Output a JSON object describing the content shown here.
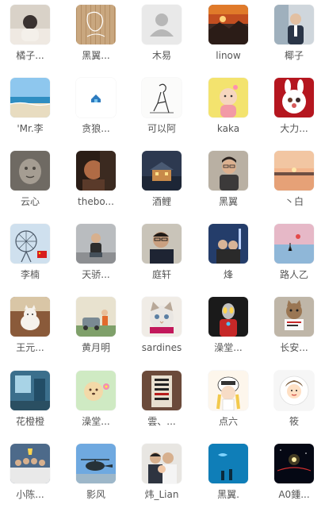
{
  "contacts": [
    {
      "name": "橘子...",
      "avatar": "photo-person-woman-light"
    },
    {
      "name": "黑翼...",
      "avatar": "photo-sketch-wood"
    },
    {
      "name": "木易",
      "avatar": "default-user-icon"
    },
    {
      "name": "linow",
      "avatar": "photo-sunset-mountains"
    },
    {
      "name": "椰子",
      "avatar": "photo-man-suit-office"
    },
    {
      "name": "'Mr.李",
      "avatar": "photo-beach-sea"
    },
    {
      "name": "贪狼...",
      "avatar": "small-house-logo"
    },
    {
      "name": "可以阿",
      "avatar": "line-drawing-figure"
    },
    {
      "name": "kaka",
      "avatar": "photo-baby-yellow"
    },
    {
      "name": "大力...",
      "avatar": "red-bunny-family-illustration"
    },
    {
      "name": "云心",
      "avatar": "photo-stone-carving"
    },
    {
      "name": "thebo...",
      "avatar": "photo-warm-dark-portrait"
    },
    {
      "name": "酒鲤",
      "avatar": "photo-night-building"
    },
    {
      "name": "黑翼",
      "avatar": "photo-young-man-glasses"
    },
    {
      "name": "丶白",
      "avatar": "photo-sunset-lake"
    },
    {
      "name": "李楠",
      "avatar": "photo-ferris-wheel-flag"
    },
    {
      "name": "天骄...",
      "avatar": "photo-man-sitting-street"
    },
    {
      "name": "庭轩",
      "avatar": "photo-man-glasses-office"
    },
    {
      "name": "烽",
      "avatar": "photo-couple-city-night"
    },
    {
      "name": "路人乙",
      "avatar": "photo-pink-sky-silhouette"
    },
    {
      "name": "王元...",
      "avatar": "photo-white-cat-room"
    },
    {
      "name": "黄月明",
      "avatar": "illustration-boy-car"
    },
    {
      "name": "sardines",
      "avatar": "photo-cat-closeup"
    },
    {
      "name": "澡堂...",
      "avatar": "ultraman-figure"
    },
    {
      "name": "长安...",
      "avatar": "photo-cat-holding-sign"
    },
    {
      "name": "花橙橙",
      "avatar": "illustration-blue-room"
    },
    {
      "name": "澡堂...",
      "avatar": "cartoon-dog-flower"
    },
    {
      "name": "雲、...",
      "avatar": "photo-chinese-signboard"
    },
    {
      "name": "点六",
      "avatar": "anime-girl-helmet"
    },
    {
      "name": "筱",
      "avatar": "cartoon-character-circle"
    },
    {
      "name": "小陈...",
      "avatar": "photo-football-team-trophy"
    },
    {
      "name": "影风",
      "avatar": "photo-helicopter-sky"
    },
    {
      "name": "炜_Lian",
      "avatar": "photo-couple-baby"
    },
    {
      "name": "黑翼.",
      "avatar": "photo-aquarium-blue"
    },
    {
      "name": "A0鍾...",
      "avatar": "photo-space-dark"
    }
  ]
}
